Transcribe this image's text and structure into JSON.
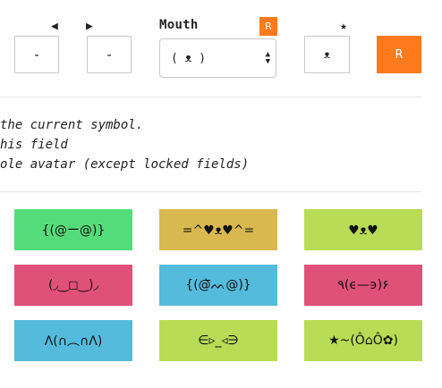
{
  "controls": {
    "left_arrow": "◀",
    "right_arrow": "▶",
    "left_value": "-",
    "right_value": "-",
    "mouth": {
      "title": "Mouth",
      "reset": "R",
      "selected": "( ᴥ )"
    },
    "star": "★",
    "star_value": "ᴥ",
    "reset_all": "R"
  },
  "help": [
    "the current symbol.",
    "his field",
    "ole avatar (except locked fields)"
  ],
  "tiles": [
    {
      "text": "{(@ー@)}",
      "color": "#55dc7a"
    },
    {
      "text": "=^♥ᴥ♥^=",
      "color": "#d9b94f"
    },
    {
      "text": "♥ᴥ♥",
      "color": "#b8dc55"
    },
    {
      "text": "(◞‿◻‿)◞",
      "color": "#e05177"
    },
    {
      "text": "{(@᷅ᨓ@)}",
      "color": "#55bbdc"
    },
    {
      "text": "٩(ϵ—϶)۶",
      "color": "#e05177"
    },
    {
      "text": "ᐱ(∩︵∩ᐱ)",
      "color": "#55bbdc"
    },
    {
      "text": "∈▹_◃∋",
      "color": "#b8dc55"
    },
    {
      "text": "★~(Ô⌂Ô✿)",
      "color": "#b8dc55"
    }
  ]
}
